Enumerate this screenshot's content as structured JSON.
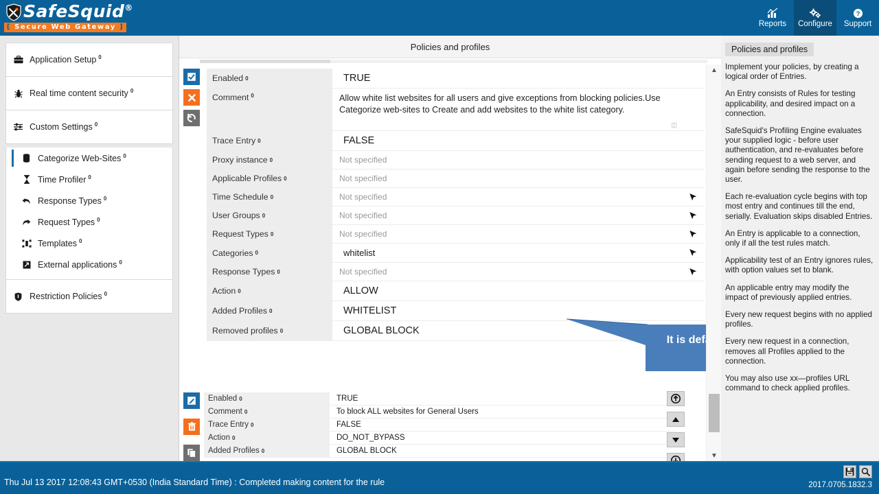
{
  "app": {
    "brand": "SafeSquid",
    "brand_reg": "®",
    "tagline": "Secure Web Gateway"
  },
  "nav": {
    "items": [
      {
        "label": "Reports",
        "icon": "chart-icon",
        "active": false
      },
      {
        "label": "Configure",
        "icon": "gears-icon",
        "active": true
      },
      {
        "label": "Support",
        "icon": "question-circle-icon",
        "active": false
      }
    ]
  },
  "sidebar": {
    "groups": [
      {
        "items": [
          {
            "label": "Application Setup",
            "icon": "briefcase-icon",
            "badge": "0"
          }
        ]
      },
      {
        "items": [
          {
            "label": "Real time content security",
            "icon": "shield-bug-icon",
            "badge": "0"
          }
        ]
      },
      {
        "items": [
          {
            "label": "Custom Settings",
            "icon": "sliders-icon",
            "badge": "0"
          }
        ]
      },
      {
        "items": [
          {
            "label": "Categorize Web-Sites",
            "icon": "database-icon",
            "badge": "0",
            "active": true
          },
          {
            "label": "Time Profiler",
            "icon": "hourglass-icon",
            "badge": "0"
          },
          {
            "label": "Response Types",
            "icon": "arrow-reply-icon",
            "badge": "0"
          },
          {
            "label": "Request Types",
            "icon": "arrow-forward-icon",
            "badge": "0"
          },
          {
            "label": "Templates",
            "icon": "templates-icon",
            "badge": "0"
          },
          {
            "label": "External applications",
            "icon": "external-app-icon",
            "badge": "0"
          }
        ]
      },
      {
        "items": [
          {
            "label": "Restriction Policies",
            "icon": "shield-icon",
            "badge": "0"
          }
        ]
      }
    ]
  },
  "main": {
    "title": "Policies and profiles",
    "entry1": {
      "actions": [
        {
          "name": "enabled-checkbox-button",
          "icon": "checkbox-checked-icon",
          "color": "#1b6ca8"
        },
        {
          "name": "delete-entry-button",
          "icon": "close-x-icon",
          "color": "#f4701f"
        },
        {
          "name": "revert-entry-button",
          "icon": "undo-icon",
          "color": "#6f6f6f"
        }
      ],
      "rows": [
        {
          "label": "Enabled",
          "badge": "0",
          "value": "TRUE",
          "style": "big",
          "cursor": false
        },
        {
          "label": "Comment",
          "badge": "0",
          "value": "Allow white list websites for all users and give exceptions from blocking policies.Use Categorize web-sites to Create and add websites to the white list category.",
          "style": "wrap",
          "cursor": false
        },
        {
          "label": "Trace Entry",
          "badge": "0",
          "value": "FALSE",
          "style": "big",
          "cursor": false
        },
        {
          "label": "Proxy instance",
          "badge": "0",
          "value": "Not specified",
          "style": "dim",
          "cursor": false
        },
        {
          "label": "Applicable Profiles",
          "badge": "0",
          "value": "Not specified",
          "style": "dim",
          "cursor": false
        },
        {
          "label": "Time Schedule",
          "badge": "0",
          "value": "Not specified",
          "style": "dim",
          "cursor": true
        },
        {
          "label": "User Groups",
          "badge": "0",
          "value": "Not specified",
          "style": "dim",
          "cursor": true
        },
        {
          "label": "Request Types",
          "badge": "0",
          "value": "Not specified",
          "style": "dim",
          "cursor": true
        },
        {
          "label": "Categories",
          "badge": "0",
          "value": "whitelist",
          "style": "norm",
          "cursor": true
        },
        {
          "label": "Response Types",
          "badge": "0",
          "value": "Not specified",
          "style": "dim",
          "cursor": true
        },
        {
          "label": "Action",
          "badge": "0",
          "value": "ALLOW",
          "style": "big",
          "cursor": false
        },
        {
          "label": "Added Profiles",
          "badge": "0",
          "value": "WHITELIST",
          "style": "big",
          "cursor": false
        },
        {
          "label": "Removed profiles",
          "badge": "0",
          "value": "GLOBAL BLOCK",
          "style": "big",
          "cursor": false
        }
      ]
    },
    "entry2": {
      "actions": [
        {
          "name": "edit-entry-button",
          "icon": "pencil-square-icon",
          "color": "#1b6ca8"
        },
        {
          "name": "delete-entry-button",
          "icon": "trash-icon",
          "color": "#f4701f"
        },
        {
          "name": "duplicate-entry-button",
          "icon": "copy-icon",
          "color": "#6f6f6f"
        }
      ],
      "rows": [
        {
          "label": "Enabled",
          "badge": "0",
          "value": "TRUE"
        },
        {
          "label": "Comment",
          "badge": "0",
          "value": "To block ALL websites for General Users"
        },
        {
          "label": "Trace Entry",
          "badge": "0",
          "value": "FALSE"
        },
        {
          "label": "Action",
          "badge": "0",
          "value": "DO_NOT_BYPASS"
        },
        {
          "label": "Added Profiles",
          "badge": "0",
          "value": "GLOBAL BLOCK"
        }
      ],
      "buttons": [
        {
          "name": "move-to-top-button",
          "icon": "circle-arrow-up-icon"
        },
        {
          "name": "move-up-button",
          "icon": "triangle-up-icon"
        },
        {
          "name": "move-down-button",
          "icon": "triangle-down-icon"
        },
        {
          "name": "move-to-bottom-button",
          "icon": "circle-arrow-down-icon"
        }
      ]
    }
  },
  "callout": {
    "text": "It is default category to allow websites",
    "color": "#4a7ebb"
  },
  "help": {
    "title": "Policies and profiles",
    "paragraphs": [
      "Implement your policies, by creating a logical order of Entries.",
      "An Entry consists of Rules for testing applicability, and desired impact on a connection.",
      "SafeSquid's Profiling Engine evaluates your supplied logic - before user authentication, and re-evaluates before sending request to a web server, and again before sending the response to the user.",
      "Each re-evaluation cycle begins with top most entry and continues till the end, serially. Evaluation skips disabled Entries.",
      "An Entry is applicable to a connection, only if all the test rules match.",
      "Applicability test of an Entry ignores rules, with option values set to blank.",
      "An applicable entry may modify the impact of previously applied entries.",
      "Every new request begins with no applied profiles.",
      "Every new request in a connection, removes all Profiles applied to the connection.",
      "You may also use xx—profiles URL command to check applied profiles."
    ]
  },
  "status": {
    "message": "Thu Jul 13 2017 12:08:43 GMT+0530 (India Standard Time) : Completed making content for the rule",
    "version": "2017.0705.1832.3",
    "buttons": [
      {
        "name": "save-button",
        "icon": "floppy-save-icon"
      },
      {
        "name": "search-button",
        "icon": "search-icon"
      }
    ]
  },
  "colors": {
    "brand_blue": "#0a6199",
    "accent_orange": "#f4701f",
    "active_blue": "#1b6ca8",
    "callout_blue": "#4a7ebb"
  }
}
